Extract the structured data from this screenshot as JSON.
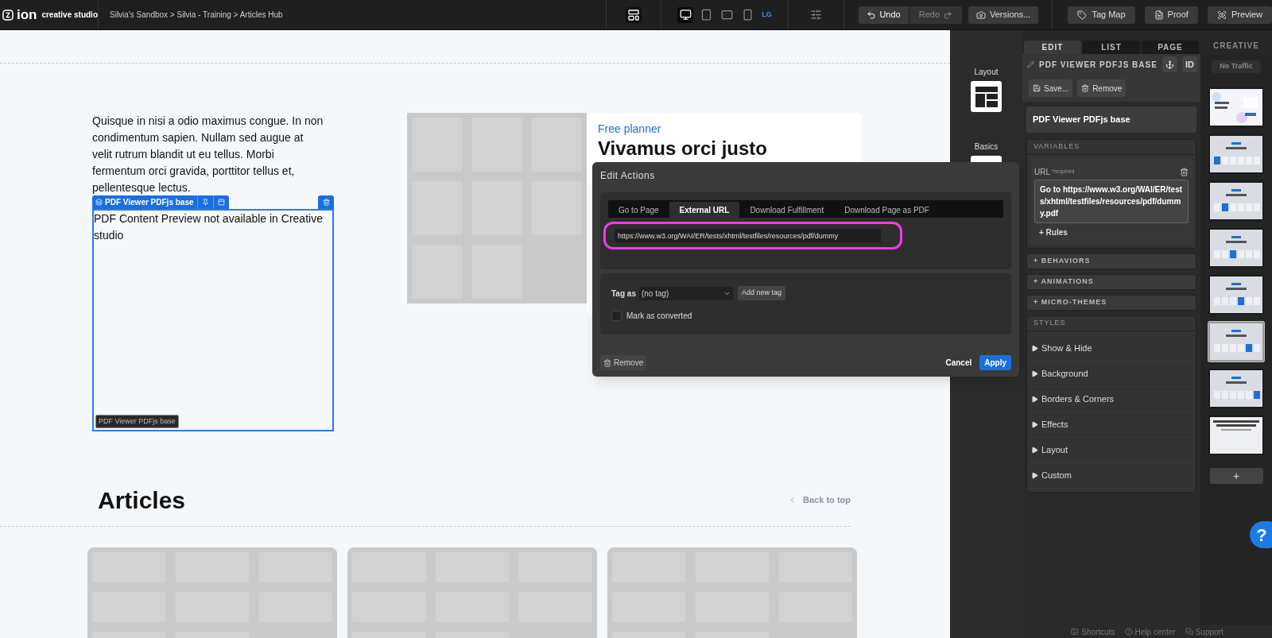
{
  "app": {
    "logo": "ion",
    "product": "creative studio"
  },
  "breadcrumb": "Silvia's Sandbox > Silvia - Training > Articles Hub",
  "toolbar": {
    "devices": [
      {
        "kind": "desktop",
        "selected": true
      },
      {
        "kind": "tablet",
        "selected": false
      },
      {
        "kind": "tablet-landscape",
        "selected": false
      },
      {
        "kind": "phone",
        "selected": false
      }
    ],
    "breakpoint": "LG",
    "undo": {
      "label": "Undo",
      "disabled": false
    },
    "redo": {
      "label": "Redo",
      "disabled": true
    },
    "versions": "Versions...",
    "tag_map": "Tag Map",
    "proof": "Proof",
    "preview": "Preview"
  },
  "canvas": {
    "paragraph": "Quisque in nisi a odio maximus congue. In non condimentum sapien. Nullam sed augue at velit rutrum blandit ut eu tellus. Morbi fermentum orci gravida, porttitor tellus et, pellentesque lectus.",
    "element": {
      "label": "PDF Viewer PDFjs base",
      "content": "PDF Content Preview not available in Creative studio",
      "footer_label": "PDF Viewer PDFjs base"
    },
    "card": {
      "eyebrow": "Free planner",
      "title": "Vivamus orci justo"
    },
    "articles_heading": "Articles",
    "back_to_top": "Back to top"
  },
  "dialog": {
    "title": "Edit Actions",
    "tabs": [
      {
        "label": "Go to Page",
        "selected": false
      },
      {
        "label": "External URL",
        "selected": true
      },
      {
        "label": "Download Fulfillment",
        "selected": false
      },
      {
        "label": "Download Page as PDF",
        "selected": false
      }
    ],
    "url": "https://www.w3.org/WAI/ER/tests/xhtml/testfiles/resources/pdf/dummy",
    "tag_label": "Tag as",
    "tag_value": "(no tag)",
    "add_tag": "Add new tag",
    "mark_converted": {
      "label": "Mark as converted",
      "checked": false
    },
    "remove": "Remove",
    "cancel": "Cancel",
    "apply": "Apply"
  },
  "tools": [
    {
      "label": "Layout"
    },
    {
      "label": "Basics"
    }
  ],
  "panel": {
    "tabs": [
      {
        "label": "EDIT",
        "selected": true
      },
      {
        "label": "LIST",
        "selected": false
      },
      {
        "label": "PAGE",
        "selected": false
      }
    ],
    "element_title": "PDF VIEWER PDFJS BASE",
    "id_button": "ID",
    "save": "Save...",
    "remove": "Remove",
    "name": "PDF Viewer PDFjs base",
    "variables_heading": "VARIABLES",
    "url_label": "URL",
    "required": "*required",
    "url_value": "Go to https://www.w3.org/WAI/ER/tests/xhtml/testfiles/resources/pdf/dummy.pdf",
    "rules": "+ Rules",
    "sections": [
      "+ BEHAVIORS",
      "+ ANIMATIONS",
      "+ MICRO-THEMES"
    ],
    "styles_heading": "STYLES",
    "styles": [
      {
        "label": "Show & Hide",
        "expanded": false
      },
      {
        "label": "Background",
        "expanded": false
      },
      {
        "label": "Borders & Corners",
        "expanded": false
      },
      {
        "label": "Effects",
        "expanded": false
      },
      {
        "label": "Layout",
        "expanded": false
      },
      {
        "label": "Custom",
        "expanded": false
      }
    ]
  },
  "creative": {
    "heading": "CREATIVE",
    "traffic": "No Traffic",
    "add": "+",
    "thumbnails": [
      {
        "kind": "hero",
        "selected": false
      },
      {
        "kind": "carousel",
        "selected": false
      },
      {
        "kind": "carousel",
        "selected": false
      },
      {
        "kind": "carousel",
        "selected": false
      },
      {
        "kind": "carousel",
        "selected": false
      },
      {
        "kind": "carousel",
        "selected": true
      },
      {
        "kind": "carousel",
        "selected": false
      },
      {
        "kind": "text",
        "selected": false
      }
    ]
  },
  "help": "?",
  "footer": [
    "Shortcuts",
    "Help center",
    "Support"
  ]
}
